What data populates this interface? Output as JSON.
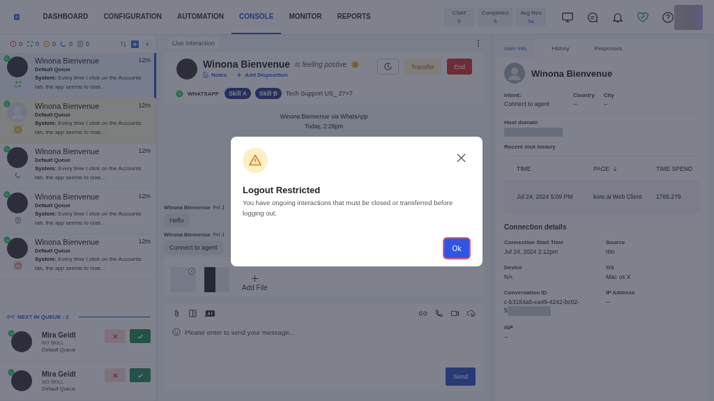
{
  "nav": {
    "tabs": [
      {
        "label": "DASHBOARD",
        "selected": false
      },
      {
        "label": "CONFIGURATION",
        "selected": false
      },
      {
        "label": "AUTOMATION",
        "selected": false
      },
      {
        "label": "CONSOLE",
        "selected": true
      },
      {
        "label": "MONITOR",
        "selected": false
      },
      {
        "label": "REPORTS",
        "selected": false
      }
    ],
    "stats": [
      {
        "label": "CSAT",
        "value": "0"
      },
      {
        "label": "Completed",
        "value": "5"
      },
      {
        "label": "Avg Res",
        "value": "5s"
      }
    ]
  },
  "left": {
    "filters": [
      {
        "kind": "alert",
        "count": "0"
      },
      {
        "kind": "transfer",
        "count": "0"
      },
      {
        "kind": "waiting",
        "count": "0"
      },
      {
        "kind": "idle",
        "count": "0"
      },
      {
        "kind": "note",
        "count": "0"
      }
    ],
    "conversations": [
      {
        "name": "Winona Bienvenue",
        "time": "12m",
        "queue": "Default Queue",
        "sender": "System:",
        "message": "Every time I click on the Accounts tab, the app seems to cras...",
        "kind": "transfer",
        "has_photo": true,
        "selected": true
      },
      {
        "name": "Winona Bienvenue",
        "time": "12m",
        "queue": "Default Queue",
        "sender": "System:",
        "message": "Every time I click on the Accounts tab, the app seems to cras...",
        "kind": "waiting",
        "has_photo": false,
        "selected": false
      },
      {
        "name": "Winona Bienvenue",
        "time": "12m",
        "queue": "Default Queue",
        "sender": "System:",
        "message": "Every time I click on the Accounts tab, the app seems to cras...",
        "kind": "idle",
        "has_photo": true,
        "selected": false
      },
      {
        "name": "Winona Bienvenue",
        "time": "12m",
        "queue": "Default Queue",
        "sender": "System:",
        "message": "Every time I click on the Accounts tab, the app seems to cras...",
        "kind": "note",
        "has_photo": true,
        "selected": false
      },
      {
        "name": "Winona Bienvenue",
        "time": "12m",
        "queue": "Default Queue",
        "sender": "System:",
        "message": "Every time I click on the Accounts tab, the app seems to cras...",
        "kind": "alert",
        "has_photo": true,
        "selected": false
      }
    ],
    "queue": {
      "title": "NEXT IN QUEUE : 2",
      "items": [
        {
          "name": "Mira Geidt",
          "skill": "NO SKILL",
          "queue": "Default Queue"
        },
        {
          "name": "Mira Geidt",
          "skill": "NO SKILL",
          "queue": "Default Queue"
        }
      ]
    }
  },
  "interaction": {
    "title": "Live Interaction",
    "name": "Winona Bienvenue",
    "mood": "is feeling postive",
    "notes": "Notes",
    "disposition": "Add Disposition",
    "transfer": "Transfer",
    "end": "End",
    "channel": "WHATSAPP",
    "skills": [
      "Skill A",
      "Skill B"
    ],
    "queue": "Tech Support US_ 27×7",
    "banner": "Winona Bienvenue via WhatsApp",
    "date": "Today, 2:28pm",
    "messages": [
      {
        "sender": "Winona Bienvenue",
        "time": "Fri J",
        "text": "Hello"
      },
      {
        "sender": "Winona Bienvenue",
        "time": "Fri J",
        "text": "Connect to agent"
      }
    ],
    "add_file": "Add File",
    "placeholder": "Please enter to send your message...",
    "send": "Send"
  },
  "user_info": {
    "tabs": [
      {
        "label": "User Info",
        "selected": true
      },
      {
        "label": "History",
        "selected": false
      },
      {
        "label": "Responses",
        "selected": false
      }
    ],
    "name": "Winona Bienvenue",
    "intent_label": "Intent:",
    "intent": "Connect to agent",
    "fields": [
      {
        "label": "Country",
        "value": "--"
      },
      {
        "label": "City",
        "value": "--"
      }
    ],
    "host_label": "Host domain",
    "visits_label": "Recent visit history",
    "visit_columns": [
      "TIME",
      "PAGE",
      "TIME SPEND"
    ],
    "visits": [
      [
        "Jul 24, 2024 5:09 PM",
        "kore.ai Web Client",
        "1785.279"
      ]
    ],
    "connection_title": "Connection details",
    "connection": [
      {
        "label": "Connection Start Time",
        "value": "Jul 24, 2024 2:12pm"
      },
      {
        "label": "Source",
        "value": "rtm"
      },
      {
        "label": "Device",
        "value": "NA"
      },
      {
        "label": "OS",
        "value": "Mac os X"
      },
      {
        "label": "Conversation ID",
        "value": "c-b3184a6-ea49-4242-bc02-5",
        "redacted": true
      },
      {
        "label": "IP Address",
        "value": "--"
      },
      {
        "label": "ISP",
        "value": "--"
      }
    ]
  },
  "dialog": {
    "title": "Logout Restricted",
    "message": "You have ongoing interactions that must be closed or transferred before logging out.",
    "ok": "Ok"
  }
}
